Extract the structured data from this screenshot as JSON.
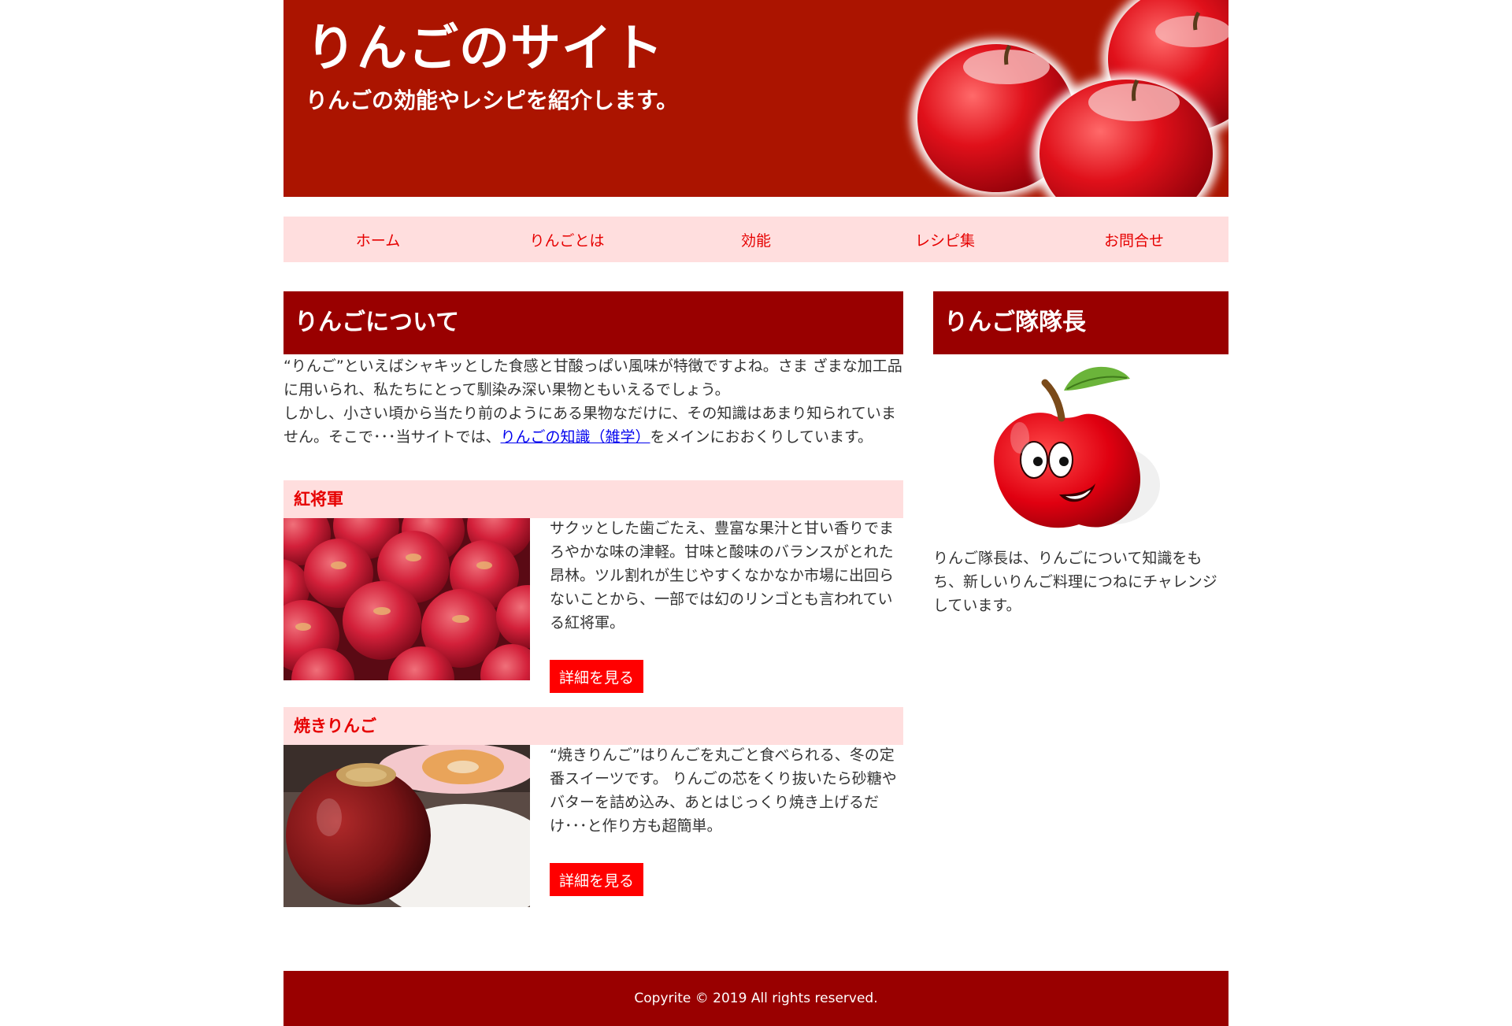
{
  "header": {
    "title": "りんごのサイト",
    "subtitle": "りんごの効能やレシピを紹介します。"
  },
  "nav": {
    "items": [
      {
        "label": "ホーム"
      },
      {
        "label": "りんごとは"
      },
      {
        "label": "効能"
      },
      {
        "label": "レシピ集"
      },
      {
        "label": "お問合せ"
      }
    ]
  },
  "main": {
    "title": "りんごについて",
    "intro_p1": "“りんご”といえばシャキッとした食感と甘酸っぱい風味が特徴ですよね。さま ざまな加工品に用いられ、私たちにとって馴染み深い果物ともいえるでしょう。",
    "intro_p2_before": "しかし、小さい頃から当たり前のようにある果物なだけに、その知識はあまり知られていません。そこで･･･当サイトでは、",
    "intro_link": "りんごの知識（雑学）",
    "intro_p2_after": "をメインにおおくりしています。",
    "articles": [
      {
        "heading": "紅将軍",
        "text": "サクッとした歯ごたえ、豊富な果汁と甘い香りでまろやかな味の津軽。甘味と酸味のバランスがとれた昂林。ツル割れが生じやすくなかなか市場に出回らないことから、一部では幻のリンゴとも言われている紅将軍。",
        "button": "詳細を見る"
      },
      {
        "heading": "焼きりんご",
        "text": "“焼きりんご”はりんごを丸ごと食べられる、冬の定番スイーツです。 りんごの芯をくり抜いたら砂糖やバターを詰め込み、あとはじっくり焼き上げるだけ･･･と作り方も超簡単。",
        "button": "詳細を見る"
      }
    ]
  },
  "sidebar": {
    "title": "りんご隊隊長",
    "text": "りんご隊長は、りんごについて知識をもち、新しいりんご料理につねにチャレンジしています。"
  },
  "footer": {
    "text": "Copyrite © 2019 All rights reserved."
  },
  "colors": {
    "header_bg": "#ab1400",
    "section_bg": "#990000",
    "nav_bg": "#ffdede",
    "accent": "#ff0000",
    "link": "#0000ee"
  }
}
